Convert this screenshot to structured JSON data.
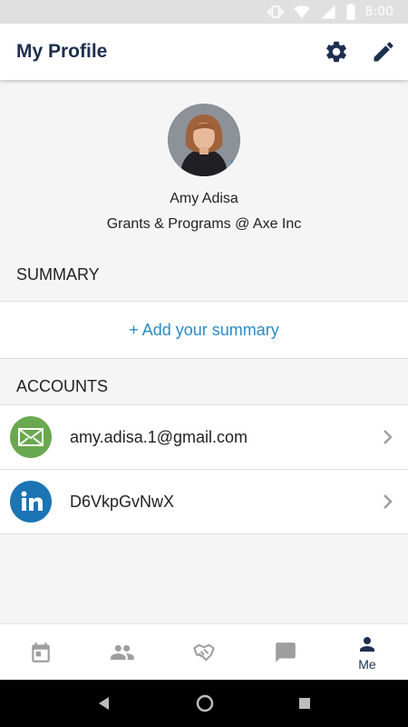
{
  "status_bar": {
    "time": "8:00",
    "icons": [
      "vibrate-icon",
      "wifi-icon",
      "signal-lte-icon",
      "battery-icon"
    ]
  },
  "app_bar": {
    "title": "My Profile",
    "actions": [
      "gear-icon",
      "pencil-icon"
    ]
  },
  "profile": {
    "name": "Amy Adisa",
    "role": "Grants & Programs @ Axe Inc"
  },
  "summary": {
    "header": "SUMMARY",
    "add_label": "+ Add your summary"
  },
  "accounts": {
    "header": "ACCOUNTS",
    "items": [
      {
        "label": "amy.adisa.1@gmail.com",
        "icon": "email-icon",
        "color": "#6aa84f"
      },
      {
        "label": "D6VkpGvNwX",
        "icon": "linkedin-icon",
        "color": "#1b74b4"
      }
    ]
  },
  "bottom_nav": {
    "items": [
      {
        "icon": "calendar-icon",
        "label": ""
      },
      {
        "icon": "people-icon",
        "label": ""
      },
      {
        "icon": "handshake-icon",
        "label": ""
      },
      {
        "icon": "chat-icon",
        "label": ""
      },
      {
        "icon": "person-icon",
        "label": "Me",
        "active": true
      }
    ]
  },
  "colors": {
    "brand_dark": "#1d2f4f",
    "link": "#2a8bc8",
    "inactive_icon": "#9e9e9e",
    "email_green": "#6aa84f",
    "linkedin_blue": "#1b74b4"
  }
}
